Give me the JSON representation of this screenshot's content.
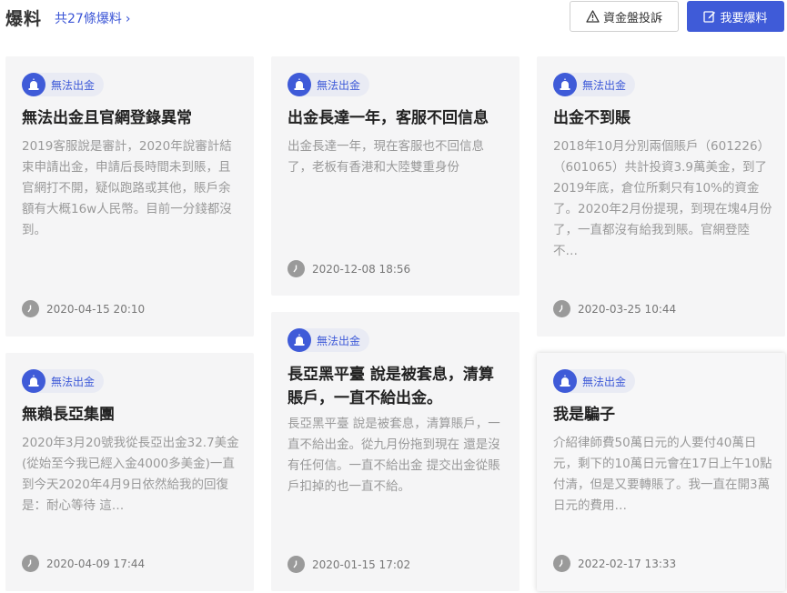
{
  "header": {
    "title": "爆料",
    "count_label": "共27條爆料",
    "count_chevron": "›",
    "complain_button": "資金盤投訴",
    "report_button": "我要爆料"
  },
  "accent_color": "#3f5bd8",
  "cards": [
    {
      "tag": "無法出金",
      "title": "無法出金且官網登錄異常",
      "body": "2019客服說是審計，2020年說審計結束申請出金，申請后長時間未到賬，且官網打不開，疑似跑路或其他，賬戶余額有大概16w人民幣。目前一分錢都沒到。",
      "time": "2020-04-15 20:10"
    },
    {
      "tag": "無法出金",
      "title": "出金長達一年，客服不回信息",
      "body": "出金長達一年，現在客服也不回信息了，老板有香港和大陸雙重身份",
      "time": "2020-12-08 18:56"
    },
    {
      "tag": "無法出金",
      "title": "出金不到賬",
      "body": "2018年10月分別兩個賬戶（601226）（601065）共計投資3.9萬美金，到了2019年底，倉位所剩只有10%的資金了。2020年2月份提現，到現在塊4月份了，一直都沒有給我到賬。官網登陸不…",
      "time": "2020-03-25 10:44"
    },
    {
      "tag": "無法出金",
      "title": "無賴長亞集團",
      "body": "2020年3月20號我從長亞出金32.7美金(從始至今我已經入金4000多美金)一直到今天2020年4月9日依然給我的回復是：耐心等待 這…",
      "time": "2020-04-09 17:44"
    },
    {
      "tag": "無法出金",
      "title": "長亞黑平臺 說是被套息，清算賬戶，一直不給出金。",
      "body": "長亞黑平臺 說是被套息，清算賬戶，一直不給出金。從九月份拖到現在 還是沒有任何信。一直不給出金 提交出金從賬戶扣掉的也一直不給。",
      "time": "2020-01-15 17:02"
    },
    {
      "tag": "無法出金",
      "title": "我是騙子",
      "body": "介紹律師費50萬日元的人要付40萬日元，剩下的10萬日元會在17日上午10點付清，但是又要轉賬了。我一直在開3萬日元的費用…",
      "time": "2022-02-17 13:33"
    }
  ]
}
